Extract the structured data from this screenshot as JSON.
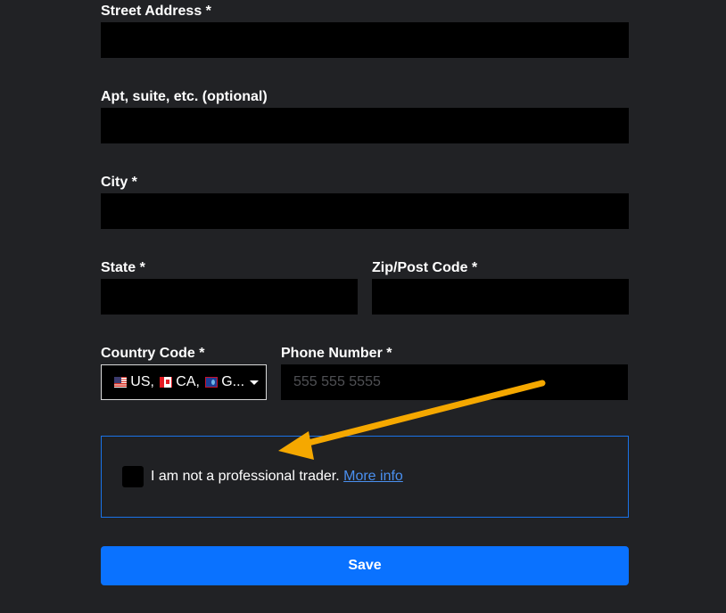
{
  "form": {
    "street_address": {
      "label": "Street Address *",
      "value": ""
    },
    "apt": {
      "label": "Apt, suite, etc. (optional)",
      "value": ""
    },
    "city": {
      "label": "City *",
      "value": ""
    },
    "state": {
      "label": "State *",
      "value": ""
    },
    "zip": {
      "label": "Zip/Post Code *",
      "value": ""
    },
    "country_code": {
      "label": "Country Code *",
      "selected": [
        "US,",
        "CA,",
        "G..."
      ],
      "flags": [
        "us-flag-icon",
        "ca-flag-icon",
        "gu-flag-icon"
      ]
    },
    "phone": {
      "label": "Phone Number *",
      "placeholder": "555 555 5555",
      "value": ""
    }
  },
  "trader": {
    "text": "I am not a professional trader.",
    "link": "More info",
    "checked": false
  },
  "save_label": "Save",
  "colors": {
    "background": "#212225",
    "input_bg": "#000000",
    "accent": "#0a72ff",
    "box_border": "#1a73e8",
    "link": "#4a90f0",
    "arrow": "#f5a800"
  }
}
